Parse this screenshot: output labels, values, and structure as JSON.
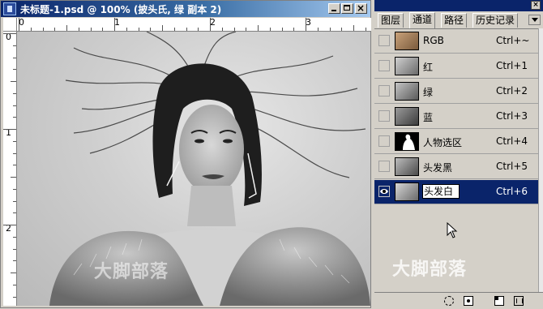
{
  "document": {
    "title": "未标题-1.psd @ 100% (披头氏, 绿 副本 2)",
    "ruler_h_numbers": [
      "0",
      "1",
      "2",
      "3"
    ],
    "ruler_v_numbers": [
      "0",
      "1",
      "2"
    ],
    "watermark_text": "大脚部落",
    "icons": {
      "app": "photoshop-document-icon",
      "minimize": "minimize-icon",
      "maximize": "maximize-icon",
      "close": "close-icon"
    }
  },
  "palette": {
    "tabs": [
      {
        "label": "图层",
        "active": false
      },
      {
        "label": "通道",
        "active": true
      },
      {
        "label": "路径",
        "active": false
      },
      {
        "label": "历史记录",
        "active": false
      }
    ],
    "channels": [
      {
        "name": "RGB",
        "shortcut": "Ctrl+~",
        "thumb": "color",
        "visible": false,
        "selected": false
      },
      {
        "name": "红",
        "shortcut": "Ctrl+1",
        "thumb": "gray",
        "visible": false,
        "selected": false
      },
      {
        "name": "绿",
        "shortcut": "Ctrl+2",
        "thumb": "gray",
        "visible": false,
        "selected": false
      },
      {
        "name": "蓝",
        "shortcut": "Ctrl+3",
        "thumb": "gray-dark",
        "visible": false,
        "selected": false
      },
      {
        "name": "人物选区",
        "shortcut": "Ctrl+4",
        "thumb": "mask",
        "visible": false,
        "selected": false
      },
      {
        "name": "头发黑",
        "shortcut": "Ctrl+5",
        "thumb": "gray",
        "visible": false,
        "selected": false
      },
      {
        "name": "头发白",
        "shortcut": "Ctrl+6",
        "thumb": "gray",
        "visible": true,
        "selected": true
      }
    ],
    "watermark_text": "大脚部落",
    "bottom_icons": [
      "load-selection-icon",
      "save-selection-icon",
      "new-channel-icon",
      "delete-channel-icon"
    ]
  }
}
